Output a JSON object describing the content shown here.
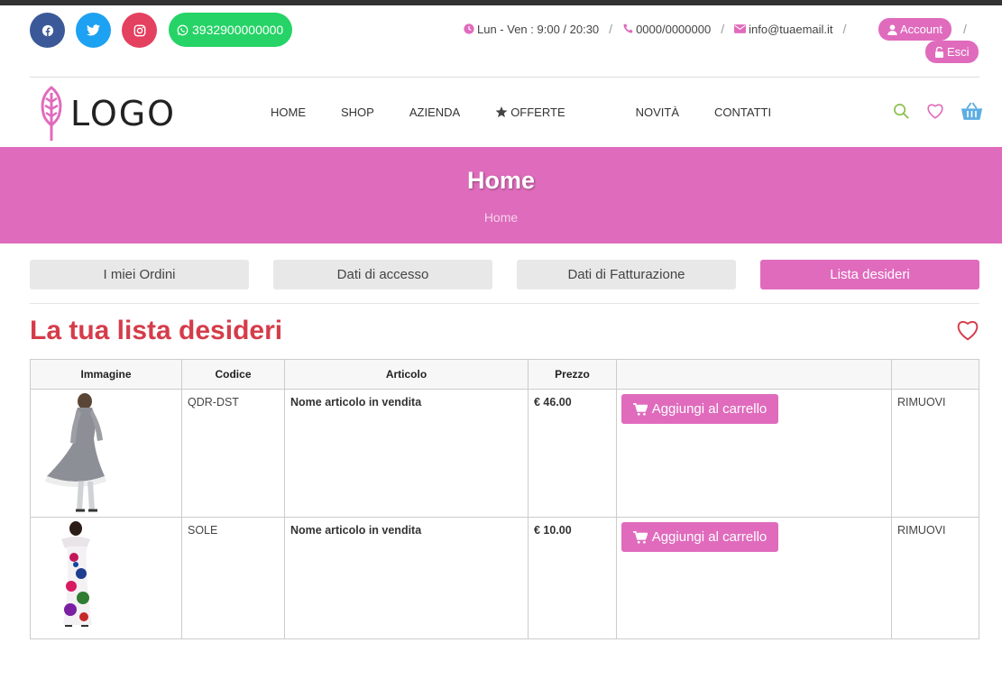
{
  "topbar": {
    "whatsapp": "3932900000000",
    "hours": "Lun - Ven : 9:00 / 20:30",
    "phone": "0000/0000000",
    "email": "info@tuaemail.it",
    "account": "Account",
    "logout": "Esci",
    "separator": "/"
  },
  "header": {
    "logo_text": "LOGO",
    "nav": [
      "HOME",
      "SHOP",
      "AZIENDA",
      "OFFERTE",
      "NOVITÀ",
      "CONTATTI"
    ]
  },
  "banner": {
    "title": "Home",
    "breadcrumb": "Home"
  },
  "tabs": [
    "I miei Ordini",
    "Dati di accesso",
    "Dati di Fatturazione",
    "Lista desideri"
  ],
  "active_tab": "Lista desideri",
  "page_title": "La tua lista desideri",
  "table": {
    "headers": [
      "Immagine",
      "Codice",
      "Articolo",
      "Prezzo",
      "",
      ""
    ],
    "rows": [
      {
        "code": "QDR-DST",
        "name": "Nome articolo in vendita",
        "price": "€ 46.00",
        "add": "Aggiungi al carrello",
        "remove": "RIMUOVI"
      },
      {
        "code": "SOLE",
        "name": "Nome articolo in vendita",
        "price": "€ 10.00",
        "add": "Aggiungi al carrello",
        "remove": "RIMUOVI"
      }
    ]
  },
  "colors": {
    "accent": "#de6bbb",
    "title": "#d53c4a",
    "facebook": "#3b5998",
    "twitter": "#1da1f2",
    "instagram": "#e4405f",
    "whatsapp": "#25d366"
  },
  "icons": [
    "facebook-icon",
    "twitter-icon",
    "instagram-icon",
    "whatsapp-icon",
    "clock-icon",
    "phone-icon",
    "envelope-icon",
    "user-icon",
    "unlock-icon",
    "star-icon",
    "search-icon",
    "heart-icon",
    "basket-icon",
    "cart-icon"
  ]
}
